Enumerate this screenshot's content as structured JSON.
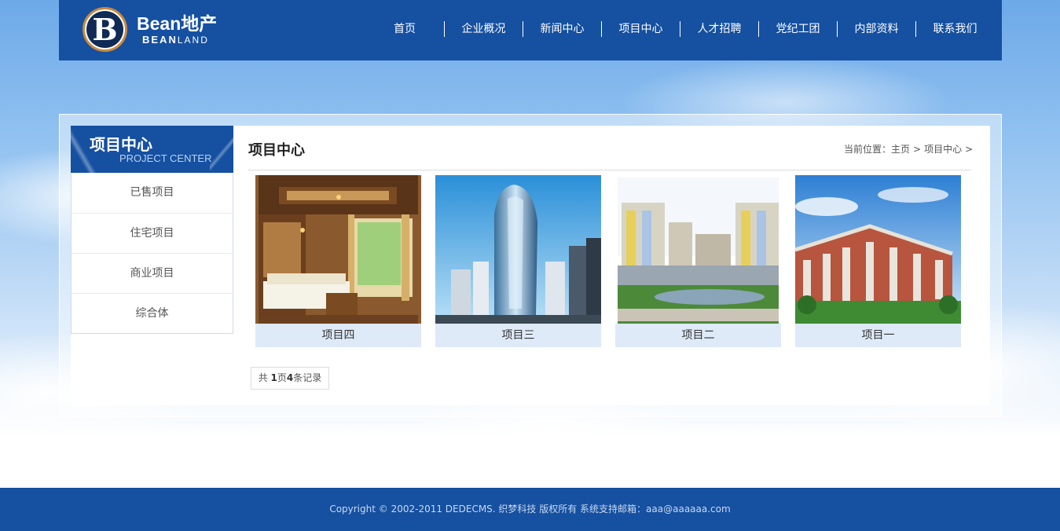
{
  "brand": {
    "logo_letter": "B",
    "name": "Bean地产",
    "sub_bold": "BEAN",
    "sub_rest": "LAND",
    "primary_color": "#1550a1"
  },
  "nav": {
    "items": [
      {
        "label": "首页"
      },
      {
        "label": "企业概况"
      },
      {
        "label": "新闻中心"
      },
      {
        "label": "项目中心"
      },
      {
        "label": "人才招聘"
      },
      {
        "label": "党纪工团"
      },
      {
        "label": "内部资料"
      },
      {
        "label": "联系我们"
      }
    ]
  },
  "sidebar": {
    "title": "项目中心",
    "subtitle": "PROJECT CENTER",
    "items": [
      {
        "label": "已售项目"
      },
      {
        "label": "住宅项目"
      },
      {
        "label": "商业项目"
      },
      {
        "label": "综合体"
      }
    ]
  },
  "main": {
    "title": "项目中心",
    "breadcrumb": {
      "prefix": "当前位置：",
      "home": "主页",
      "sep": ">",
      "current": "项目中心"
    }
  },
  "projects": [
    {
      "caption": "项目四",
      "image": "bedroom-interior-photo"
    },
    {
      "caption": "项目三",
      "image": "glass-skyscraper-photo"
    },
    {
      "caption": "项目二",
      "image": "residential-towers-photo"
    },
    {
      "caption": "项目一",
      "image": "apartment-building-photo"
    }
  ],
  "pager": {
    "prefix": "共 ",
    "pages": "1",
    "mid": "页",
    "records": "4",
    "suffix": "条记录"
  },
  "footer": {
    "text": "Copyright © 2002-2011 DEDECMS. 织梦科技 版权所有 系统支持邮箱：aaa@aaaaaa.com"
  }
}
